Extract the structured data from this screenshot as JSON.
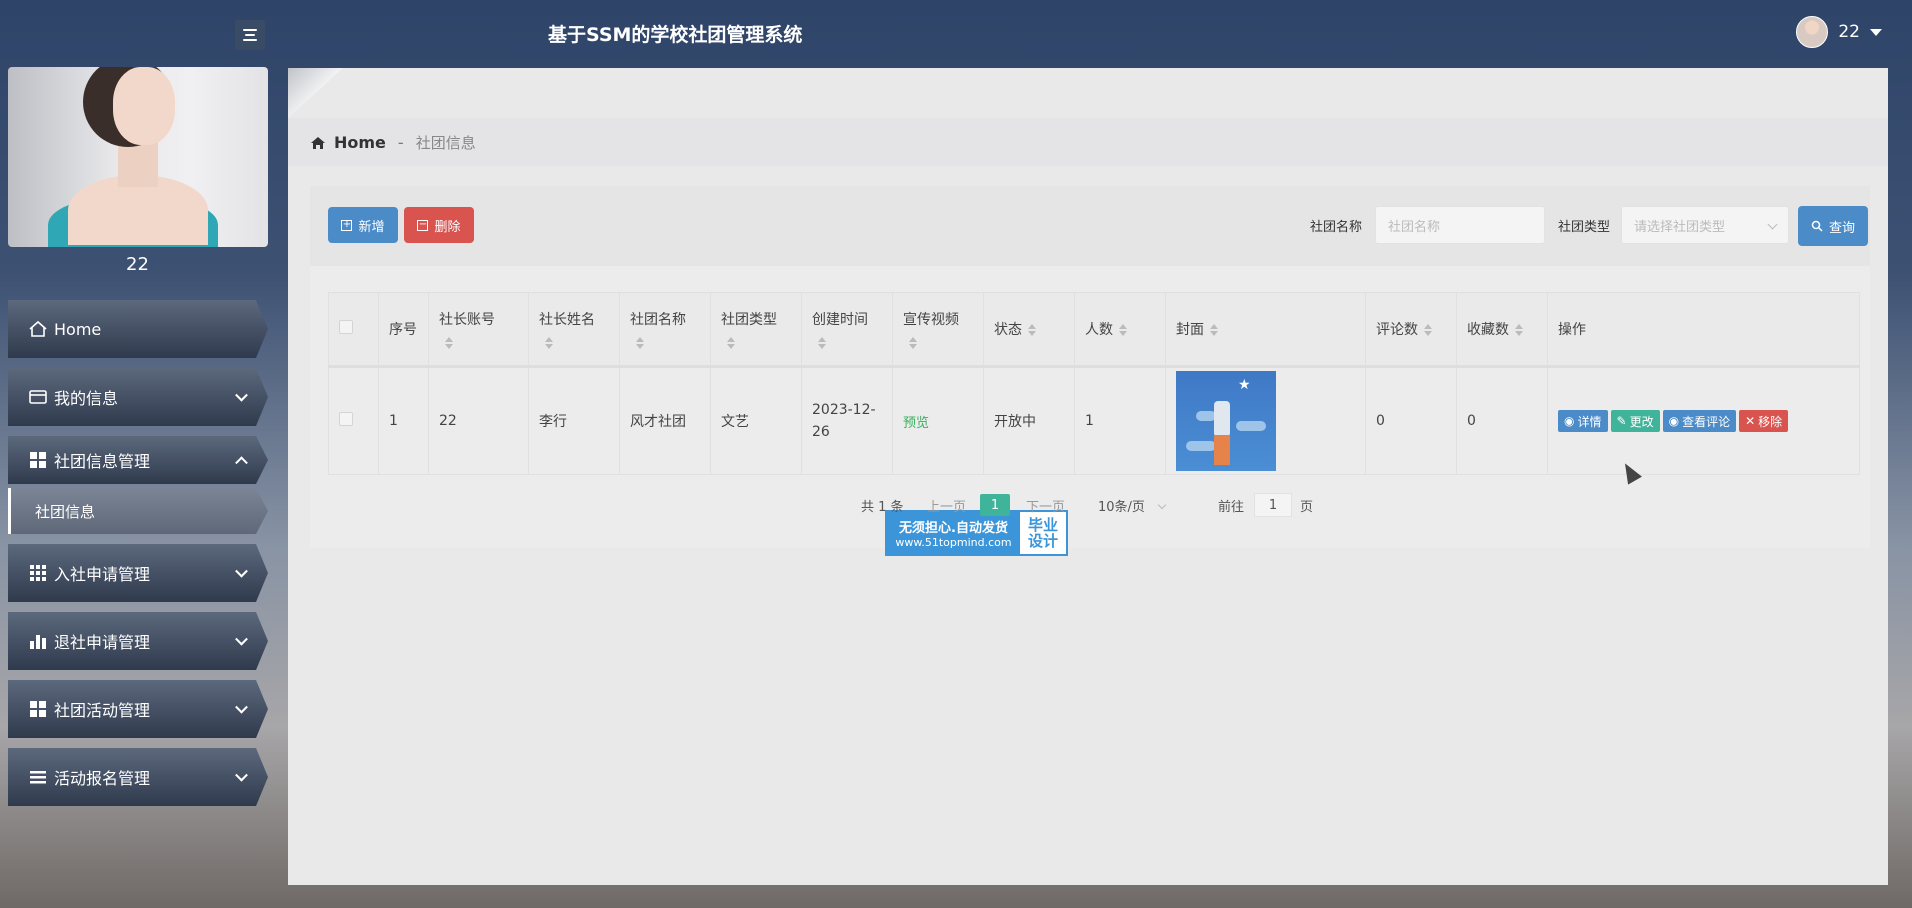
{
  "header": {
    "title": "基于SSM的学校社团管理系统",
    "username": "22"
  },
  "sidebar": {
    "profile_name": "22",
    "items": [
      {
        "label": "Home",
        "icon": "home-icon"
      },
      {
        "label": "我的信息",
        "icon": "id-card-icon"
      },
      {
        "label": "社团信息管理",
        "icon": "grid-icon",
        "expanded": true,
        "children": [
          {
            "label": "社团信息"
          }
        ]
      },
      {
        "label": "入社申请管理",
        "icon": "apps-icon"
      },
      {
        "label": "退社申请管理",
        "icon": "bar-chart-icon"
      },
      {
        "label": "社团活动管理",
        "icon": "grid-icon"
      },
      {
        "label": "活动报名管理",
        "icon": "list-icon"
      }
    ]
  },
  "breadcrumb": {
    "home": "Home",
    "separator": "-",
    "current": "社团信息"
  },
  "toolbar": {
    "add_label": "新增",
    "delete_label": "删除",
    "name_filter_label": "社团名称",
    "name_filter_placeholder": "社团名称",
    "type_filter_label": "社团类型",
    "type_filter_placeholder": "请选择社团类型",
    "query_label": "查询"
  },
  "table": {
    "columns": [
      "序号",
      "社长账号",
      "社长姓名",
      "社团名称",
      "社团类型",
      "创建时间",
      "宣传视频",
      "状态",
      "人数",
      "封面",
      "评论数",
      "收藏数",
      "操作"
    ],
    "rows": [
      {
        "index": "1",
        "leader_account": "22",
        "leader_name": "李行",
        "club_name": "风才社团",
        "club_type": "文艺",
        "created": "2023-12-26",
        "video": "预览",
        "status": "开放中",
        "members": "1",
        "comments": "0",
        "favorites": "0",
        "ops": [
          "详情",
          "更改",
          "查看评论",
          "移除"
        ]
      }
    ]
  },
  "pager": {
    "total": "共 1 条",
    "prev": "上一页",
    "current": "1",
    "next": "下一页",
    "page_size": "10条/页",
    "goto_prefix": "前往",
    "goto_value": "1",
    "goto_suffix": "页"
  },
  "watermark": {
    "line1": "无须担心.自动发货",
    "url": "www.51topmind.com",
    "right1": "毕业",
    "right2": "设计"
  },
  "colors": {
    "primary": "#4b8bc8",
    "danger": "#d9534f",
    "success": "#3fb49a"
  }
}
